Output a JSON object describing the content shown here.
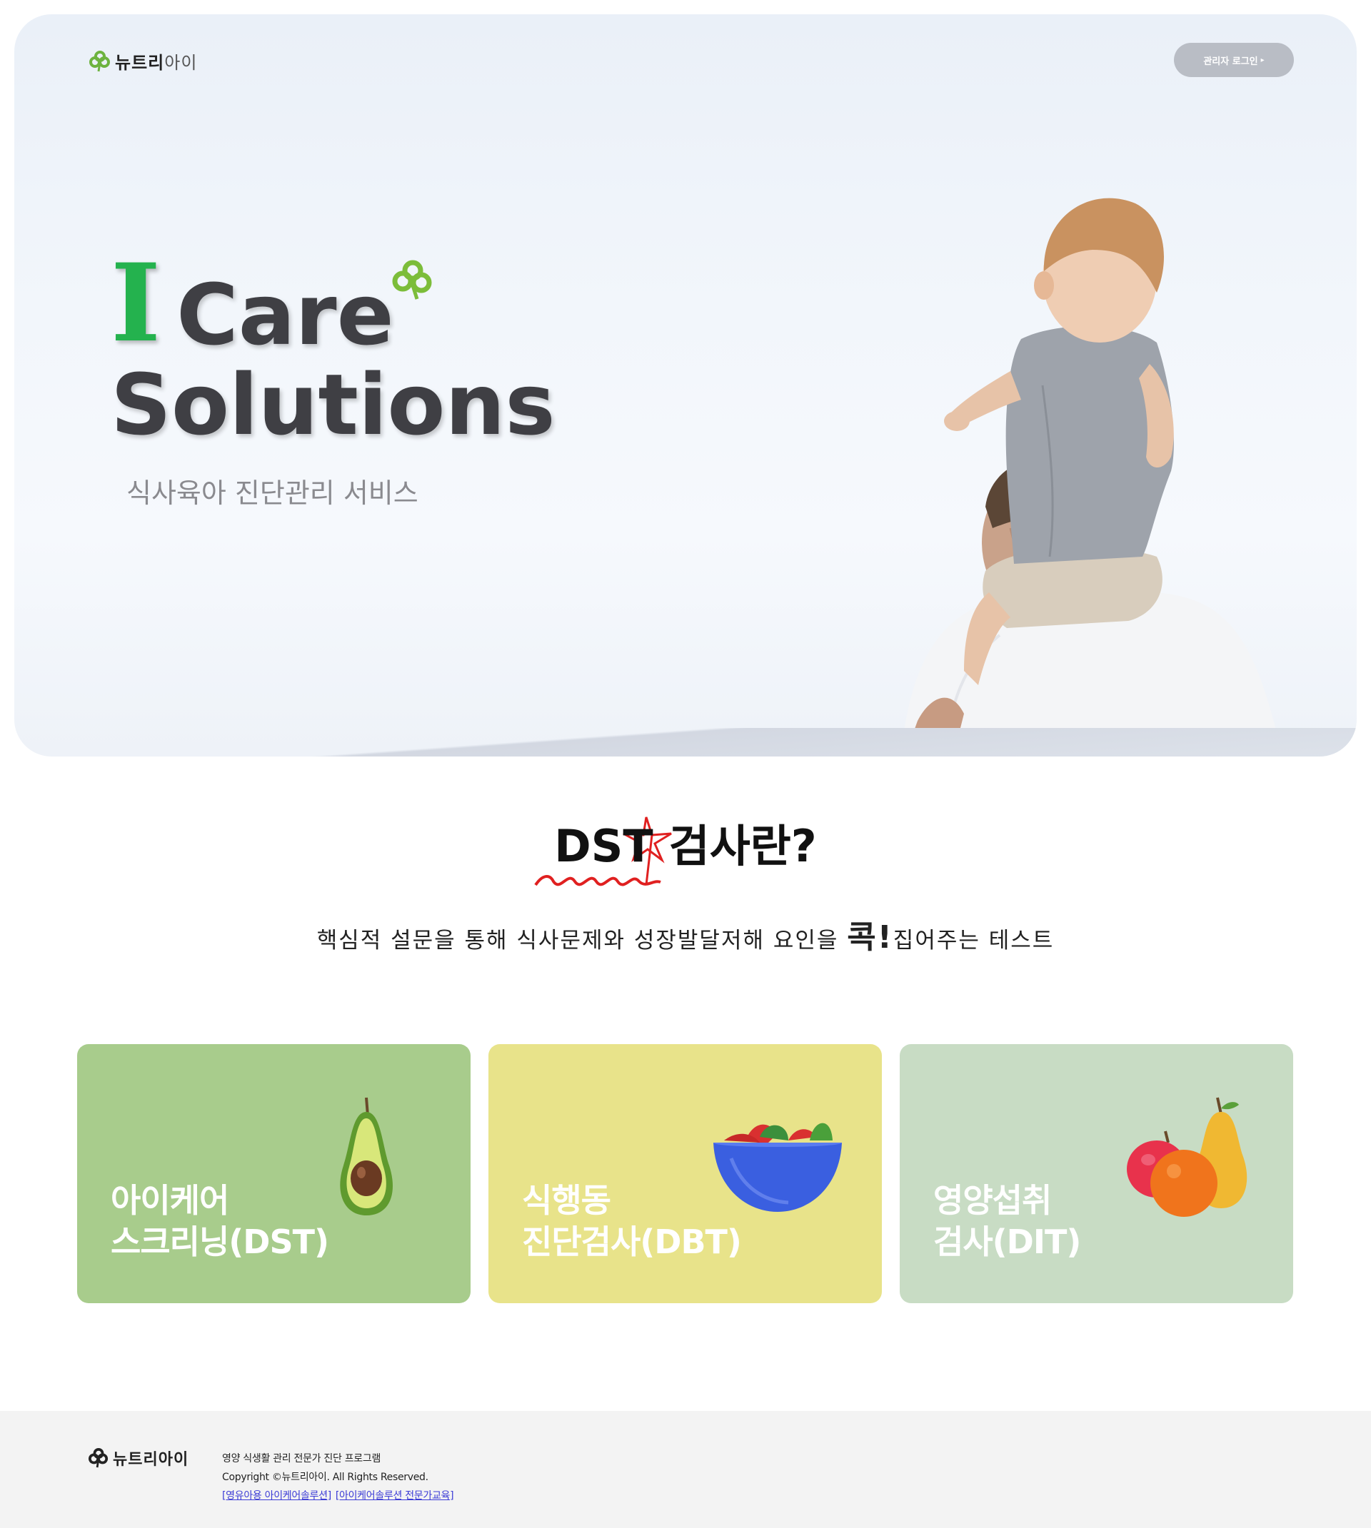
{
  "header": {
    "logo_text_bold": "뉴트리",
    "logo_text_light": "아이",
    "admin_login_label": "관리자 로그인"
  },
  "hero": {
    "title_i": "I",
    "title_care": "Care",
    "title_solutions": "Solutions",
    "subtitle": "식사육아 진단관리 서비스"
  },
  "dst": {
    "heading_prefix": "DST",
    "heading_suffix": "검사란?",
    "desc_before": "핵심적 설문을 통해 식사문제와 성장발달저해 요인을 ",
    "desc_emphasis": "콕!",
    "desc_after": "집어주는 테스트"
  },
  "cards": [
    {
      "line1": "아이케어",
      "line2": "스크리닝(DST)",
      "icon": "avocado-icon",
      "color": "#a8cc8c"
    },
    {
      "line1": "식행동",
      "line2": "진단검사(DBT)",
      "icon": "salad-bowl-icon",
      "color": "#e8e38a"
    },
    {
      "line1": "영양섭취",
      "line2": "검사(DIT)",
      "icon": "fruits-icon",
      "color": "#c8dcc4"
    }
  ],
  "footer": {
    "logo_text_bold": "뉴트리",
    "logo_text_light": "아이",
    "tagline": "영양 식생활 관리 전문가 진단 프로그램",
    "copyright": "Copyright ©뉴트리아이. All Rights Reserved.",
    "link_1": "[영유아용 아이케어솔루션]",
    "link_2": "[아이케어솔루션 전문가교육]"
  },
  "colors": {
    "brand_green": "#24b24e",
    "clover_green": "#6db33f",
    "title_gray": "#3f3f44",
    "admin_button": "#b9bdc5"
  }
}
